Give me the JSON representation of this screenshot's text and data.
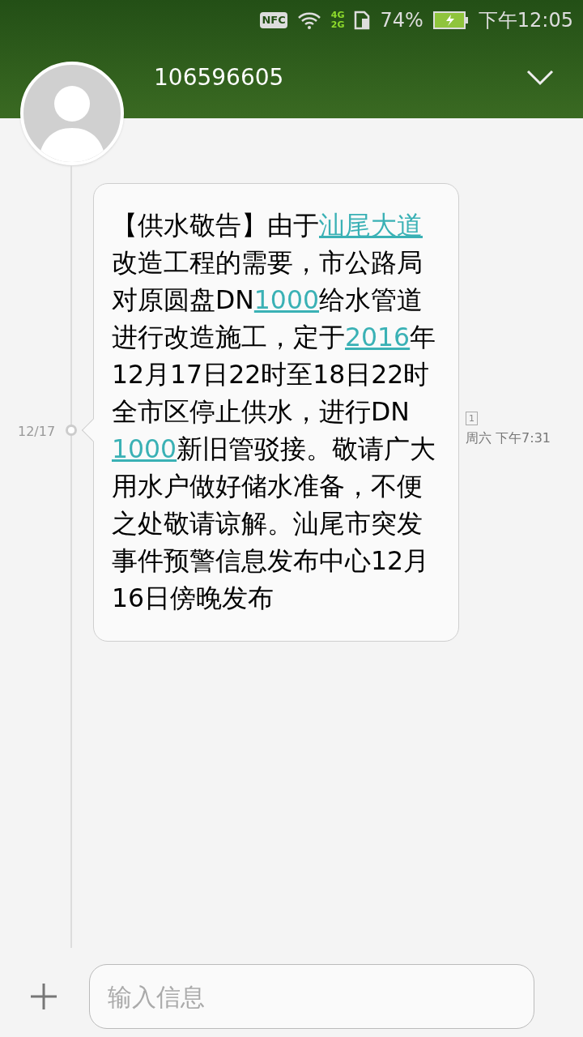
{
  "status_bar": {
    "network_top": "4G",
    "network_bottom": "2G",
    "battery": "74%",
    "time": "下午12:05",
    "nfc": "NFC"
  },
  "header": {
    "sender": "106596605"
  },
  "messages": [
    {
      "date": "12/17",
      "sim": "1",
      "time": "周六 下午7:31",
      "segments": [
        {
          "text": "【供水敬告】由于",
          "link": false
        },
        {
          "text": "汕尾大道",
          "link": true
        },
        {
          "text": "改造工程的需要，市公路局对原圆盘DN",
          "link": false
        },
        {
          "text": "1000",
          "link": true
        },
        {
          "text": "给水管道进行改造施工，定于",
          "link": false
        },
        {
          "text": "2016",
          "link": true
        },
        {
          "text": "年12月17日22时至18日22时全市区停止供水，进行DN",
          "link": false
        },
        {
          "text": "1000",
          "link": true
        },
        {
          "text": "新旧管驳接。敬请广大用水户做好储水准备，不便之处敬请谅解。汕尾市突发事件预警信息发布中心12月16日傍晚发布",
          "link": false
        }
      ]
    }
  ],
  "composer": {
    "placeholder": "输入信息"
  }
}
